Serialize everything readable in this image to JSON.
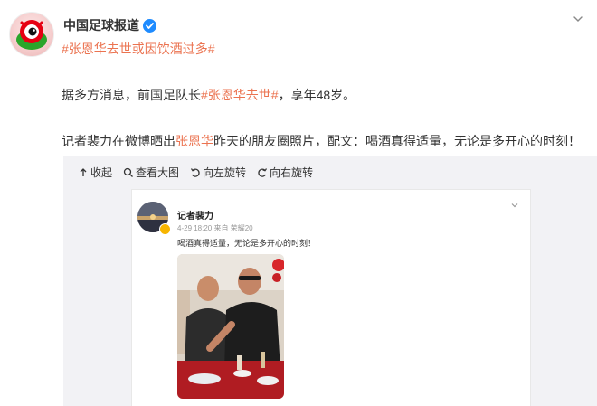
{
  "post": {
    "author": "中国足球报道",
    "topic_tag": "#张恩华去世",
    "topic_suffix": "或因饮酒过多#",
    "para1_before": "据多方消息，前国足队长",
    "para1_tag": "#张恩华去世#",
    "para1_after": "，享年48岁。",
    "para2_before": "记者裴力在微博晒出",
    "para2_link": "张恩华",
    "para2_after": "昨天的朋友圈照片，配文：喝酒真得适量，无论是多开心的时刻！"
  },
  "toolbar": {
    "collapse": "收起",
    "view_large": "查看大图",
    "rotate_left": "向左旋转",
    "rotate_right": "向右旋转"
  },
  "moment_card": {
    "name": "记者裴力",
    "meta": "4-29 18:20  来自 荣耀20",
    "text": "喝酒真得适量，无论是多开心的时刻！"
  },
  "colors": {
    "link": "#eb7350",
    "verify": "#1e8bff",
    "media_bg": "#f2f2f5"
  },
  "icons": [
    "weibo-avatar-icon",
    "verified-icon",
    "chevron-down-icon",
    "collapse-icon",
    "zoom-icon",
    "rotate-left-icon",
    "rotate-right-icon"
  ]
}
